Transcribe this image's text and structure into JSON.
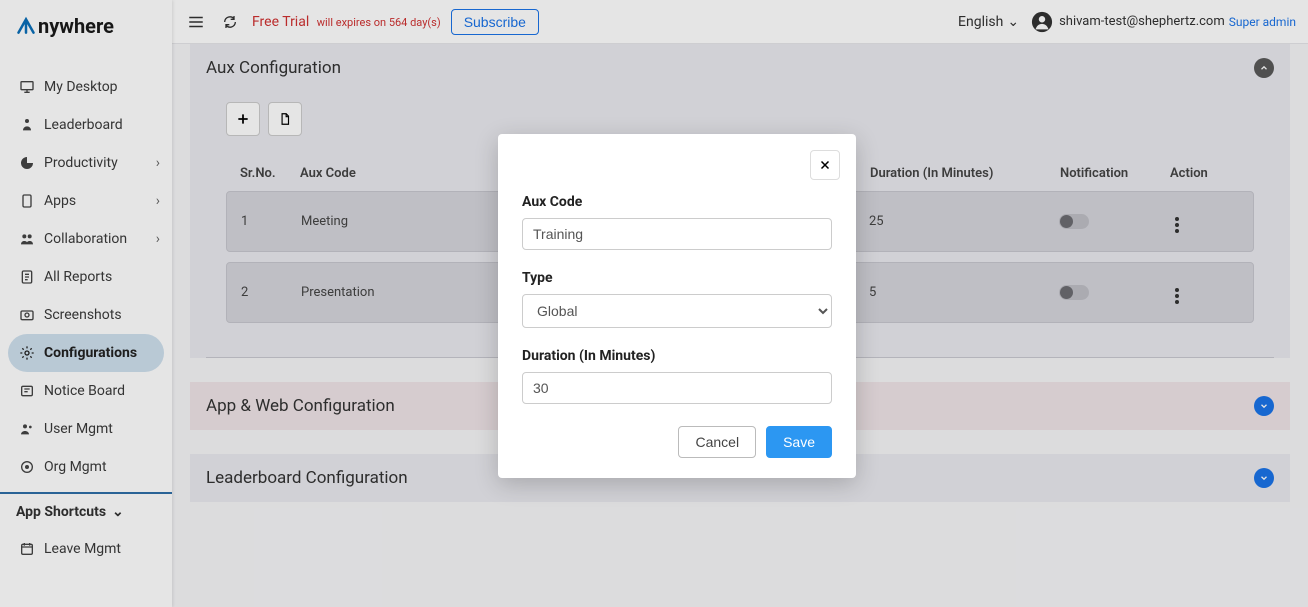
{
  "brand": {
    "name": "nywhere"
  },
  "topbar": {
    "trial_label": "Free Trial",
    "trial_expires": "will expires on 564 day(s)",
    "subscribe": "Subscribe",
    "language": "English",
    "user_email": "shivam-test@shephertz.com",
    "user_role": "Super admin"
  },
  "sidebar": {
    "items": [
      {
        "label": "My Desktop"
      },
      {
        "label": "Leaderboard"
      },
      {
        "label": "Productivity"
      },
      {
        "label": "Apps"
      },
      {
        "label": "Collaboration"
      },
      {
        "label": "All Reports"
      },
      {
        "label": "Screenshots"
      },
      {
        "label": "Configurations"
      },
      {
        "label": "Notice Board"
      },
      {
        "label": "User Mgmt"
      },
      {
        "label": "Org Mgmt"
      }
    ],
    "shortcuts_label": "App Shortcuts",
    "leave_mgmt": "Leave Mgmt"
  },
  "aux_panel": {
    "title": "Aux Configuration",
    "headers": {
      "sr": "Sr.No.",
      "code": "Aux Code",
      "duration": "Duration (In Minutes)",
      "notification": "Notification",
      "action": "Action"
    },
    "rows": [
      {
        "sr": "1",
        "code": "Meeting",
        "duration": "25"
      },
      {
        "sr": "2",
        "code": "Presentation",
        "duration": "5"
      }
    ]
  },
  "panel2": {
    "title": "App & Web Configuration"
  },
  "panel3": {
    "title": "Leaderboard Configuration"
  },
  "modal": {
    "field_code_label": "Aux Code",
    "field_code_value": "Training",
    "field_type_label": "Type",
    "field_type_value": "Global",
    "field_duration_label": "Duration (In Minutes)",
    "field_duration_value": "30",
    "cancel": "Cancel",
    "save": "Save"
  }
}
